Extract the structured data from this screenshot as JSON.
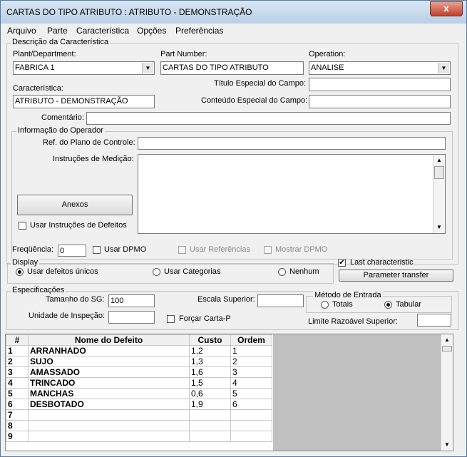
{
  "window": {
    "title": "CARTAS DO TIPO ATRIBUTO : ATRIBUTO - DEMONSTRAÇÃO",
    "close_glyph": "x"
  },
  "menu": [
    "Arquivo",
    "Parte",
    "Característica",
    "Opções",
    "Preferências"
  ],
  "descricao": {
    "legend": "Descrição da Característica",
    "plant_label": "Plant/Department:",
    "plant_value": "FABRICA 1",
    "part_label": "Part Number:",
    "part_value": "CARTAS DO TIPO ATRIBUTO",
    "operation_label": "Operation:",
    "operation_value": "ANALISE",
    "titulo_label": "Título Especial do Campo:",
    "titulo_value": "",
    "caracteristica_label": "Característica:",
    "caracteristica_value": "ATRIBUTO - DEMONSTRAÇÃO",
    "conteudo_label": "Conteúdo Especial do Campo:",
    "conteudo_value": "",
    "comentario_label": "Comentário:",
    "comentario_value": ""
  },
  "operador": {
    "legend": "Informação do Operador",
    "ref_label": "Ref. do Plano de Controle:",
    "ref_value": "",
    "instrucoes_label": "Instruções de Medição:",
    "anexos_label": "Anexos",
    "usar_instrucoes_label": "Usar Instruções de Defeitos"
  },
  "opcoes": {
    "frequencia_label": "Freqüência:",
    "frequencia_value": "0",
    "usar_dpmo_label": "Usar DPMO",
    "usar_referencias_label": "Usar Referências",
    "mostrar_dpmo_label": "Mostrar DPMO",
    "last_char_label": "Last characteristic",
    "last_char_checked": true,
    "parameter_transfer_label": "Parameter transfer"
  },
  "display": {
    "legend": "Display",
    "opt_unicos": "Usar defeitos únicos",
    "opt_categorias": "Usar Categorias",
    "opt_nenhum": "Nenhum",
    "selected": "unicos"
  },
  "especificacoes": {
    "legend": "Especificações",
    "tamanho_label": "Tamanho do SG:",
    "tamanho_value": "100",
    "escala_label": "Escala Superior:",
    "escala_value": "",
    "metodo_legend": "Método de Entrada",
    "metodo_totais": "Totais",
    "metodo_tabular": "Tabular",
    "metodo_selected": "tabular",
    "unidade_label": "Unidade de Inspeção:",
    "unidade_value": "",
    "forcar_label": "Forçar Carta-P",
    "limite_label": "Limite Razoável Superior:",
    "limite_value": ""
  },
  "grid": {
    "headers": [
      "#",
      "Nome do Defeito",
      "Custo",
      "Ordem"
    ],
    "rows": [
      [
        "1",
        "ARRANHADO",
        "1,2",
        "1"
      ],
      [
        "2",
        "SUJO",
        "1,3",
        "2"
      ],
      [
        "3",
        "AMASSADO",
        "1,6",
        "3"
      ],
      [
        "4",
        "TRINCADO",
        "1,5",
        "4"
      ],
      [
        "5",
        "MANCHAS",
        "0,6",
        "5"
      ],
      [
        "6",
        "DESBOTADO",
        "1,9",
        "6"
      ],
      [
        "7",
        "",
        "",
        ""
      ],
      [
        "8",
        "",
        "",
        ""
      ],
      [
        "9",
        "",
        "",
        ""
      ]
    ]
  },
  "glyphs": {
    "arrow_down": "▼",
    "arrow_up": "▲",
    "check": "✔"
  }
}
